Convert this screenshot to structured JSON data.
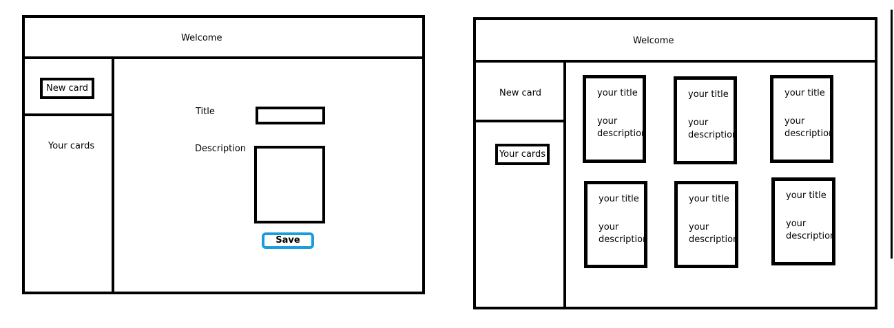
{
  "left_mockup": {
    "header": {
      "title": "Welcome"
    },
    "sidebar": {
      "new_card_label": "New card",
      "your_cards_label": "Your cards"
    },
    "form": {
      "title_label": "Title",
      "description_label": "Description",
      "save_label": "Save"
    }
  },
  "right_mockup": {
    "header": {
      "title": "Welcome"
    },
    "sidebar": {
      "new_card_label": "New card",
      "your_cards_label": "Your cards"
    },
    "cards": [
      {
        "title": "your title",
        "description": "your description"
      },
      {
        "title": "your title",
        "description": "your description"
      },
      {
        "title": "your title",
        "description": "your description"
      },
      {
        "title": "your title",
        "description": "your description"
      },
      {
        "title": "your title",
        "description": "your description"
      },
      {
        "title": "your title",
        "description": "your description"
      }
    ]
  },
  "colors": {
    "line": "#000000",
    "save_border": "#1a9de0",
    "background": "#ffffff"
  }
}
